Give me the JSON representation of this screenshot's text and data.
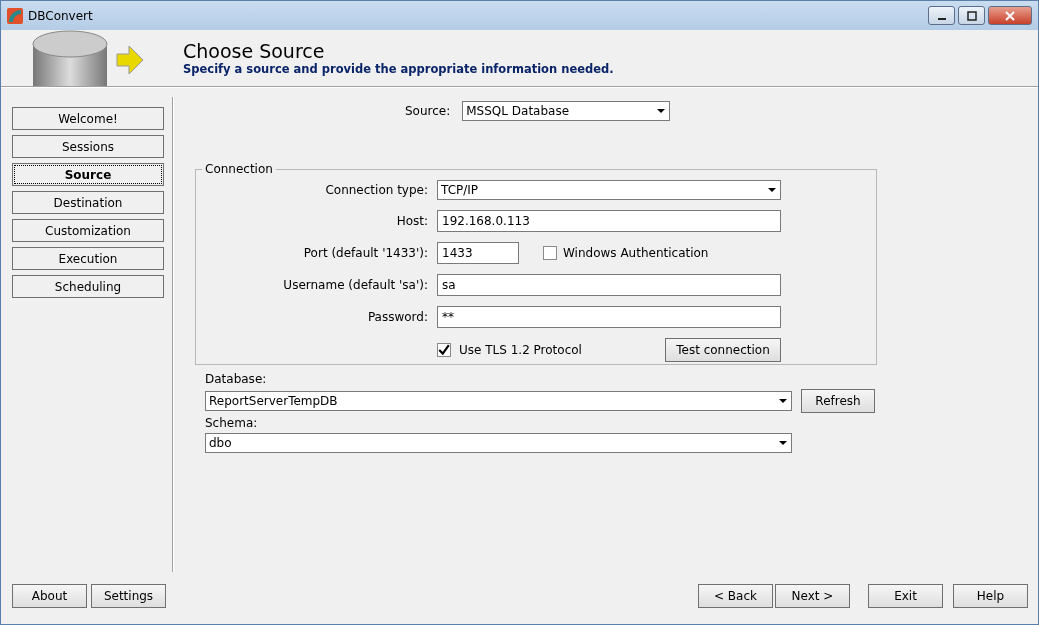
{
  "window": {
    "title": "DBConvert"
  },
  "header": {
    "title": "Choose Source",
    "subtitle": "Specify a source and provide the appropriate information needed."
  },
  "nav": [
    {
      "label": "Welcome!",
      "selected": false
    },
    {
      "label": "Sessions",
      "selected": false
    },
    {
      "label": "Source",
      "selected": true
    },
    {
      "label": "Destination",
      "selected": false
    },
    {
      "label": "Customization",
      "selected": false
    },
    {
      "label": "Execution",
      "selected": false
    },
    {
      "label": "Scheduling",
      "selected": false
    }
  ],
  "source": {
    "label": "Source:",
    "value": "MSSQL Database"
  },
  "connection": {
    "legend": "Connection",
    "connection_type": {
      "label": "Connection type:",
      "value": "TCP/IP"
    },
    "host": {
      "label": "Host:",
      "value": "192.168.0.113"
    },
    "port": {
      "label": "Port (default '1433'):",
      "value": "1433"
    },
    "windows_auth": {
      "label": "Windows Authentication",
      "checked": false
    },
    "username": {
      "label": "Username (default 'sa'):",
      "value": "sa"
    },
    "password": {
      "label": "Password:",
      "value": "**"
    },
    "tls": {
      "label": "Use TLS 1.2 Protocol",
      "checked": true
    },
    "test_button": "Test connection"
  },
  "database": {
    "label": "Database:",
    "value": "ReportServerTempDB",
    "refresh": "Refresh"
  },
  "schema": {
    "label": "Schema:",
    "value": "dbo"
  },
  "footer": {
    "left": [
      "About",
      "Settings"
    ],
    "nav": [
      "< Back",
      "Next >"
    ],
    "right": [
      "Exit",
      "Help"
    ]
  }
}
